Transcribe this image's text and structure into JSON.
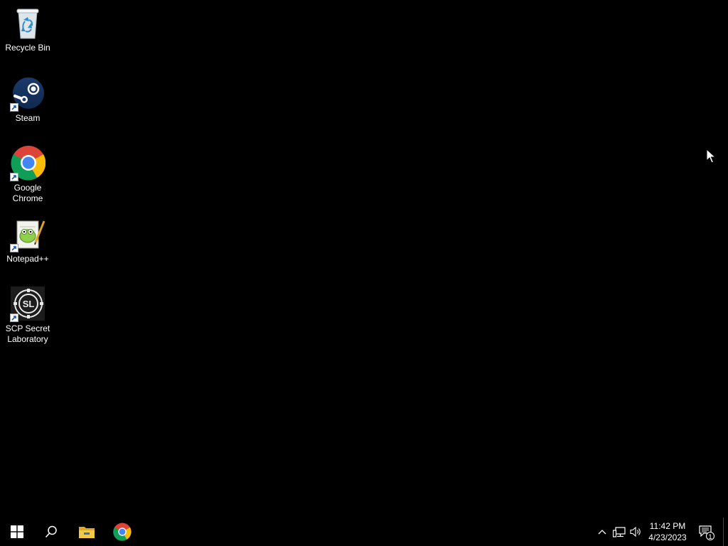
{
  "desktop": {
    "background_color": "#000000",
    "icons": [
      {
        "label": "Recycle Bin",
        "icon": "recycle-bin-icon",
        "shortcut": false
      },
      {
        "label": "Steam",
        "icon": "steam-icon",
        "shortcut": true
      },
      {
        "label": "Google Chrome",
        "icon": "chrome-icon",
        "shortcut": true
      },
      {
        "label": "Notepad++",
        "icon": "notepadpp-icon",
        "shortcut": true
      },
      {
        "label": "SCP Secret Laboratory",
        "icon": "scp-sl-icon",
        "shortcut": true
      }
    ]
  },
  "taskbar": {
    "start_icon": "windows-start-icon",
    "search_icon": "search-icon",
    "pinned": [
      {
        "icon": "file-explorer-icon"
      },
      {
        "icon": "chrome-icon"
      }
    ],
    "tray": {
      "chevron_icon": "chevron-up-icon",
      "network_icon": "network-icon",
      "volume_icon": "volume-icon",
      "time": "11:42 PM",
      "date": "4/23/2023",
      "notification_icon": "action-center-icon",
      "notification_count": "1"
    }
  }
}
